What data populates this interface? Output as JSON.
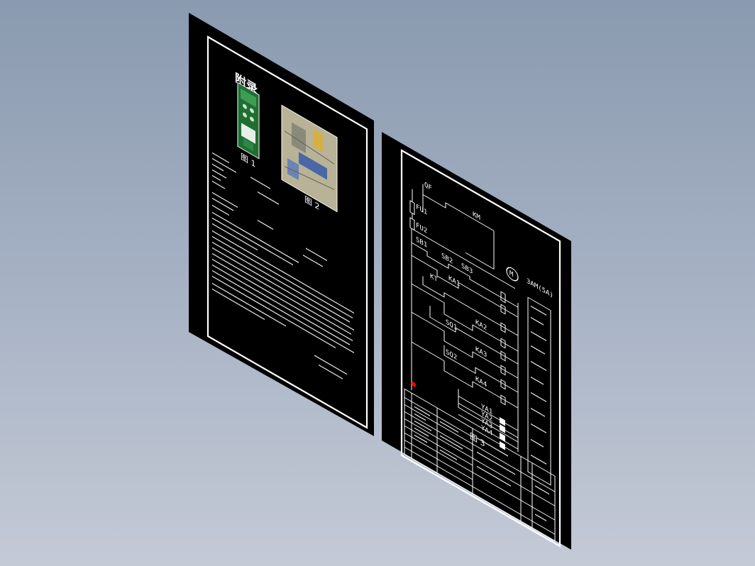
{
  "drawing": {
    "left_sheet": {
      "title": "附录",
      "figure_1_caption": "图 1",
      "figure_2_caption": "图 2"
    },
    "right_sheet": {
      "motor_label": "M",
      "motor_note": "3AM(5A)",
      "circuit_labels": [
        "QF",
        "FU1",
        "FU2",
        "KM",
        "SB1",
        "SB2",
        "SB3",
        "KA1",
        "KA2",
        "KA3",
        "KA4",
        "YA1",
        "YA2",
        "YA3",
        "YA4",
        "KT",
        "SQ1",
        "SQ2"
      ],
      "figure_caption": "图 3",
      "marker_color": "#ff0000"
    }
  }
}
